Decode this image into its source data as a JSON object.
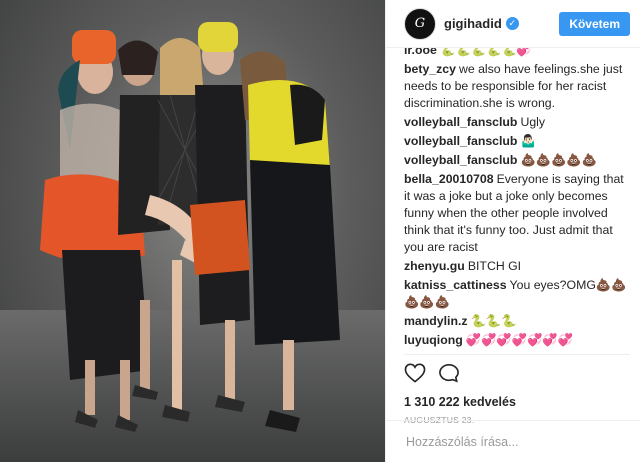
{
  "header": {
    "username": "gigihadid",
    "avatar_text": "G",
    "follow_label": "Követem"
  },
  "comments": [
    {
      "user": "lr.ooe",
      "text": "🐍🐍🐍🐍🐍💞"
    },
    {
      "user": "bety_zcy",
      "text": "we also have feelings.she just needs to be responsible for her racist discrimination.she is wrong."
    },
    {
      "user": "volleyball_fansclub",
      "text": "Ugly"
    },
    {
      "user": "volleyball_fansclub",
      "text": "🤷🏻‍♂️"
    },
    {
      "user": "volleyball_fansclub",
      "text": "💩💩💩💩💩"
    },
    {
      "user": "bella_20010708",
      "text": "Everyone is saying that it was a joke but a joke only becomes funny when the other people involved think that it's funny too. Just admit that you are racist"
    },
    {
      "user": "zhenyu.gu",
      "text": "BITCH GI"
    },
    {
      "user": "katniss_cattiness",
      "text": "You eyes?OMG💩💩💩💩💩"
    },
    {
      "user": "mandylin.z",
      "text": "🐍🐍🐍"
    },
    {
      "user": "luyuqiong",
      "text": "💞💞💞💞💞💞💞"
    },
    {
      "user": "luyuqiong",
      "text": "💩💩💩💩💩💩"
    }
  ],
  "actions": {
    "like_icon": "heart-icon",
    "comment_icon": "speech-bubble-icon",
    "likes_text": "1 310 222 kedvelés",
    "date_text": "AUGUSZTUS 23."
  },
  "add_comment": {
    "placeholder": "Hozzászólás írása..."
  },
  "colors": {
    "accent": "#3897f0",
    "text": "#262626",
    "muted": "#999999",
    "border": "#efefef"
  }
}
